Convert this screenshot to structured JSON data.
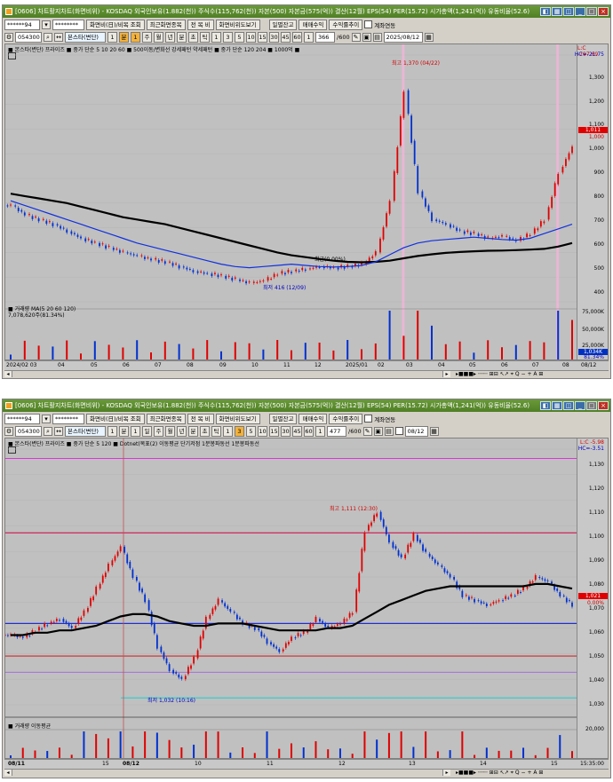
{
  "top": {
    "title": "[0606] 차트활지차트(화면비위) - KOSDAQ 외국인보유(1.882(천)) 주식수(115,762(천)) 자본(500) 자본금(575(억)) 결산(12월) EPS(54) PER(15.72) 시가총액(1,241(억)) 유동비율(52.6)",
    "tb1": {
      "code_field": "******94",
      "code_field2": "********",
      "btn1": "화면비(日)/비목 조회",
      "btn2": "최근화면종목",
      "btn3": "전 목 비",
      "btn4": "화면비위도보기",
      "btn5": "일별잔고",
      "btn6": "매매수익",
      "btn7": "수익률추이",
      "chk_label": "계좌연동"
    },
    "tb2": {
      "code": "054300",
      "name": "본스타(변단)",
      "period_buttons": [
        "1",
        "분",
        "1",
        "주",
        "월",
        "년",
        "분",
        "초",
        "틱",
        "1",
        "3",
        "5",
        "10",
        "15",
        "30",
        "45",
        "60",
        "1"
      ],
      "count": "366",
      "total": "/600",
      "date": "2025/08/12"
    },
    "legend": "■ 본스타(변단) 프라이즈 ■ 중가 단순 5  10  20  60 ■ 500이동/변화선 강세패턴  약세패턴 ■ 중가 단순 120  204 ■ 1000억 ■",
    "yticks": [
      "1,300",
      "1,200",
      "1,100",
      "1,000",
      "900",
      "800",
      "700",
      "600",
      "500",
      "400"
    ],
    "vol_yticks": [
      "75,000K",
      "50,000K",
      "25,000K"
    ],
    "right_top": [
      "L:C -797.69",
      "HC=-21.75"
    ],
    "price_box": "1,011",
    "price_box2": "1,000",
    "vol_box": "1,034K",
    "vol_box2": "81.34%",
    "ann_high": "최고 1,370 (04/22)",
    "ann_low": "최저 416 (12/09)",
    "ann_mid": "최근(0.00%)",
    "vol_legend": "■ 거래량  MA(5  20  60  120)",
    "vol_value": "7,078,620주(81.34%)",
    "xticks": [
      "2024/02 03",
      "04",
      "05",
      "06",
      "07",
      "08",
      "09",
      "10",
      "11",
      "12",
      "2025/01",
      "02",
      "03",
      "04",
      "05",
      "06",
      "07",
      "08"
    ],
    "axis_right_label": "08/12",
    "chart_data": {
      "type": "candlestick",
      "x_range": [
        "2024/02",
        "2025/08"
      ],
      "ylim": [
        350,
        1400
      ],
      "high": {
        "value": 1370,
        "date": "04/22"
      },
      "low": {
        "value": 416,
        "date": "12/09"
      },
      "series_close": [
        760,
        720,
        700,
        680,
        650,
        620,
        600,
        580,
        560,
        545,
        530,
        520,
        500,
        480,
        470,
        460,
        445,
        430,
        440,
        470,
        480,
        490,
        500,
        495,
        500,
        510,
        560,
        780,
        1250,
        820,
        700,
        680,
        650,
        640,
        620,
        630,
        610,
        640,
        700,
        900,
        1011
      ],
      "ma_black": [
        810,
        800,
        790,
        780,
        770,
        755,
        740,
        725,
        710,
        700,
        690,
        680,
        665,
        650,
        635,
        620,
        605,
        590,
        575,
        560,
        548,
        540,
        532,
        525,
        520,
        518,
        520,
        525,
        535,
        545,
        552,
        558,
        562,
        565,
        567,
        568,
        570,
        572,
        575,
        585,
        600
      ],
      "ma_blue": [
        780,
        760,
        740,
        720,
        700,
        680,
        660,
        640,
        620,
        600,
        585,
        570,
        555,
        540,
        525,
        510,
        500,
        495,
        500,
        505,
        510,
        505,
        500,
        498,
        500,
        505,
        520,
        550,
        580,
        600,
        610,
        615,
        620,
        625,
        620,
        615,
        612,
        620,
        640,
        660,
        680
      ]
    }
  },
  "bottom": {
    "title": "[0606] 차트활지차트(화면비위) - KOSDAQ 외국인보유(1.882(천)) 주식수(115,762(천)) 자본(500) 자본금(575(억)) 결산(12월) EPS(54) PER(15.72) 시가총액(1,241(억)) 유동비율(52.6)",
    "tb1": {
      "code_field": "******94",
      "code_field2": "********",
      "btn1": "화면비(日)/비목 조회",
      "btn2": "최근화면종목",
      "btn3": "전 목 비",
      "btn4": "화면비위도보기",
      "btn5": "일별잔고",
      "btn6": "매매수익",
      "btn7": "수익률추이",
      "chk_label": "계좌연동"
    },
    "tb2": {
      "code": "054300",
      "name": "본스타(변단)",
      "period_buttons": [
        "1",
        "분",
        "1",
        "일",
        "주",
        "월",
        "년",
        "분",
        "초",
        "틱",
        "1",
        "3",
        "5",
        "10",
        "15",
        "30",
        "45",
        "60",
        "1"
      ],
      "count": "477",
      "total": "/600",
      "date": "08/12"
    },
    "legend": "■ 본스타(변단) 프라이즈 ■ 중가 단순 5  120 ■ Dotnet(목표(2)  이동평균  단기저점  1분봉파동선  1분봉파동선",
    "yticks": [
      "1,130",
      "1,120",
      "1,110",
      "1,100",
      "1,090",
      "1,080",
      "1,070",
      "1,060",
      "1,050",
      "1,040",
      "1,030"
    ],
    "vol_yticks": [
      "20,000"
    ],
    "right_top": [
      "L:C -5.98",
      "HC=-3.51"
    ],
    "price_box": "1,021",
    "price_box2": "0.00%",
    "ann_high": "최고 1,111 (12:30)",
    "ann_low": "최저 1,032 (10:16)",
    "vol_legend": "■ 거래량  이동평균",
    "xticks": [
      "08/11",
      "15",
      "08/12",
      "10",
      "11",
      "12",
      "13",
      "14",
      "15"
    ],
    "axis_right_label": "15:35:00",
    "chart_data": {
      "type": "candlestick",
      "x_range": [
        "08/11",
        "08/12 15:35"
      ],
      "ylim": [
        1025,
        1135
      ],
      "high": {
        "value": 1111,
        "time": "12:30"
      },
      "low": {
        "value": 1032,
        "time": "10:16"
      },
      "hlines": [
        1131,
        1099,
        1060,
        1046,
        1039,
        1028
      ],
      "series_close": [
        1055,
        1054,
        1057,
        1060,
        1062,
        1058,
        1065,
        1075,
        1085,
        1093,
        1080,
        1070,
        1050,
        1040,
        1036,
        1045,
        1062,
        1070,
        1065,
        1060,
        1058,
        1052,
        1048,
        1054,
        1056,
        1062,
        1058,
        1060,
        1065,
        1100,
        1108,
        1095,
        1088,
        1098,
        1090,
        1085,
        1080,
        1072,
        1070,
        1068,
        1070,
        1072,
        1075,
        1080,
        1078,
        1072,
        1068
      ],
      "ma_black": [
        1055,
        1055,
        1056,
        1056,
        1057,
        1057,
        1058,
        1059,
        1061,
        1063,
        1064,
        1064,
        1063,
        1061,
        1060,
        1059,
        1059,
        1060,
        1060,
        1060,
        1059,
        1058,
        1057,
        1057,
        1057,
        1057,
        1058,
        1058,
        1059,
        1062,
        1065,
        1068,
        1070,
        1072,
        1074,
        1075,
        1076,
        1076,
        1076,
        1076,
        1076,
        1076,
        1076,
        1077,
        1077,
        1076,
        1075
      ]
    }
  }
}
